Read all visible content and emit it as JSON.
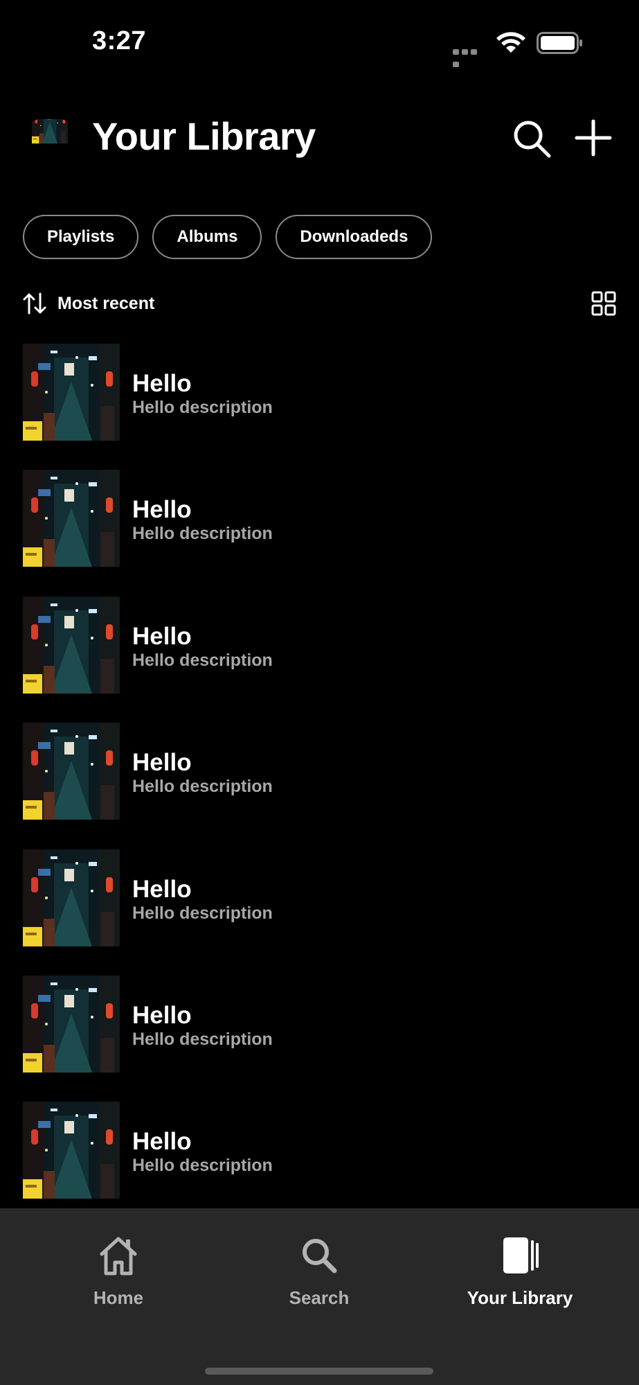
{
  "status_bar": {
    "time": "3:27"
  },
  "header": {
    "title": "Your Library",
    "avatar_icon": "alley-artwork",
    "search_icon": "search-icon",
    "add_icon": "plus-icon"
  },
  "filters": [
    {
      "label": "Playlists"
    },
    {
      "label": "Albums"
    },
    {
      "label": "Downloadeds"
    }
  ],
  "sort": {
    "label": "Most recent",
    "icon": "sort-arrows-icon",
    "view_toggle_icon": "grid-view-icon"
  },
  "items": [
    {
      "title": "Hello",
      "description": "Hello description"
    },
    {
      "title": "Hello",
      "description": "Hello description"
    },
    {
      "title": "Hello",
      "description": "Hello description"
    },
    {
      "title": "Hello",
      "description": "Hello description"
    },
    {
      "title": "Hello",
      "description": "Hello description"
    },
    {
      "title": "Hello",
      "description": "Hello description"
    },
    {
      "title": "Hello",
      "description": "Hello description"
    }
  ],
  "tab_bar": {
    "tabs": [
      {
        "label": "Home",
        "icon": "home-icon",
        "active": false
      },
      {
        "label": "Search",
        "icon": "search-icon",
        "active": false
      },
      {
        "label": "Your Library",
        "icon": "library-icon",
        "active": true
      }
    ]
  },
  "colors": {
    "background": "#000000",
    "tab_bar": "#282828",
    "secondary_text": "#a7a7a7",
    "chip_border": "#8a8a8a"
  }
}
